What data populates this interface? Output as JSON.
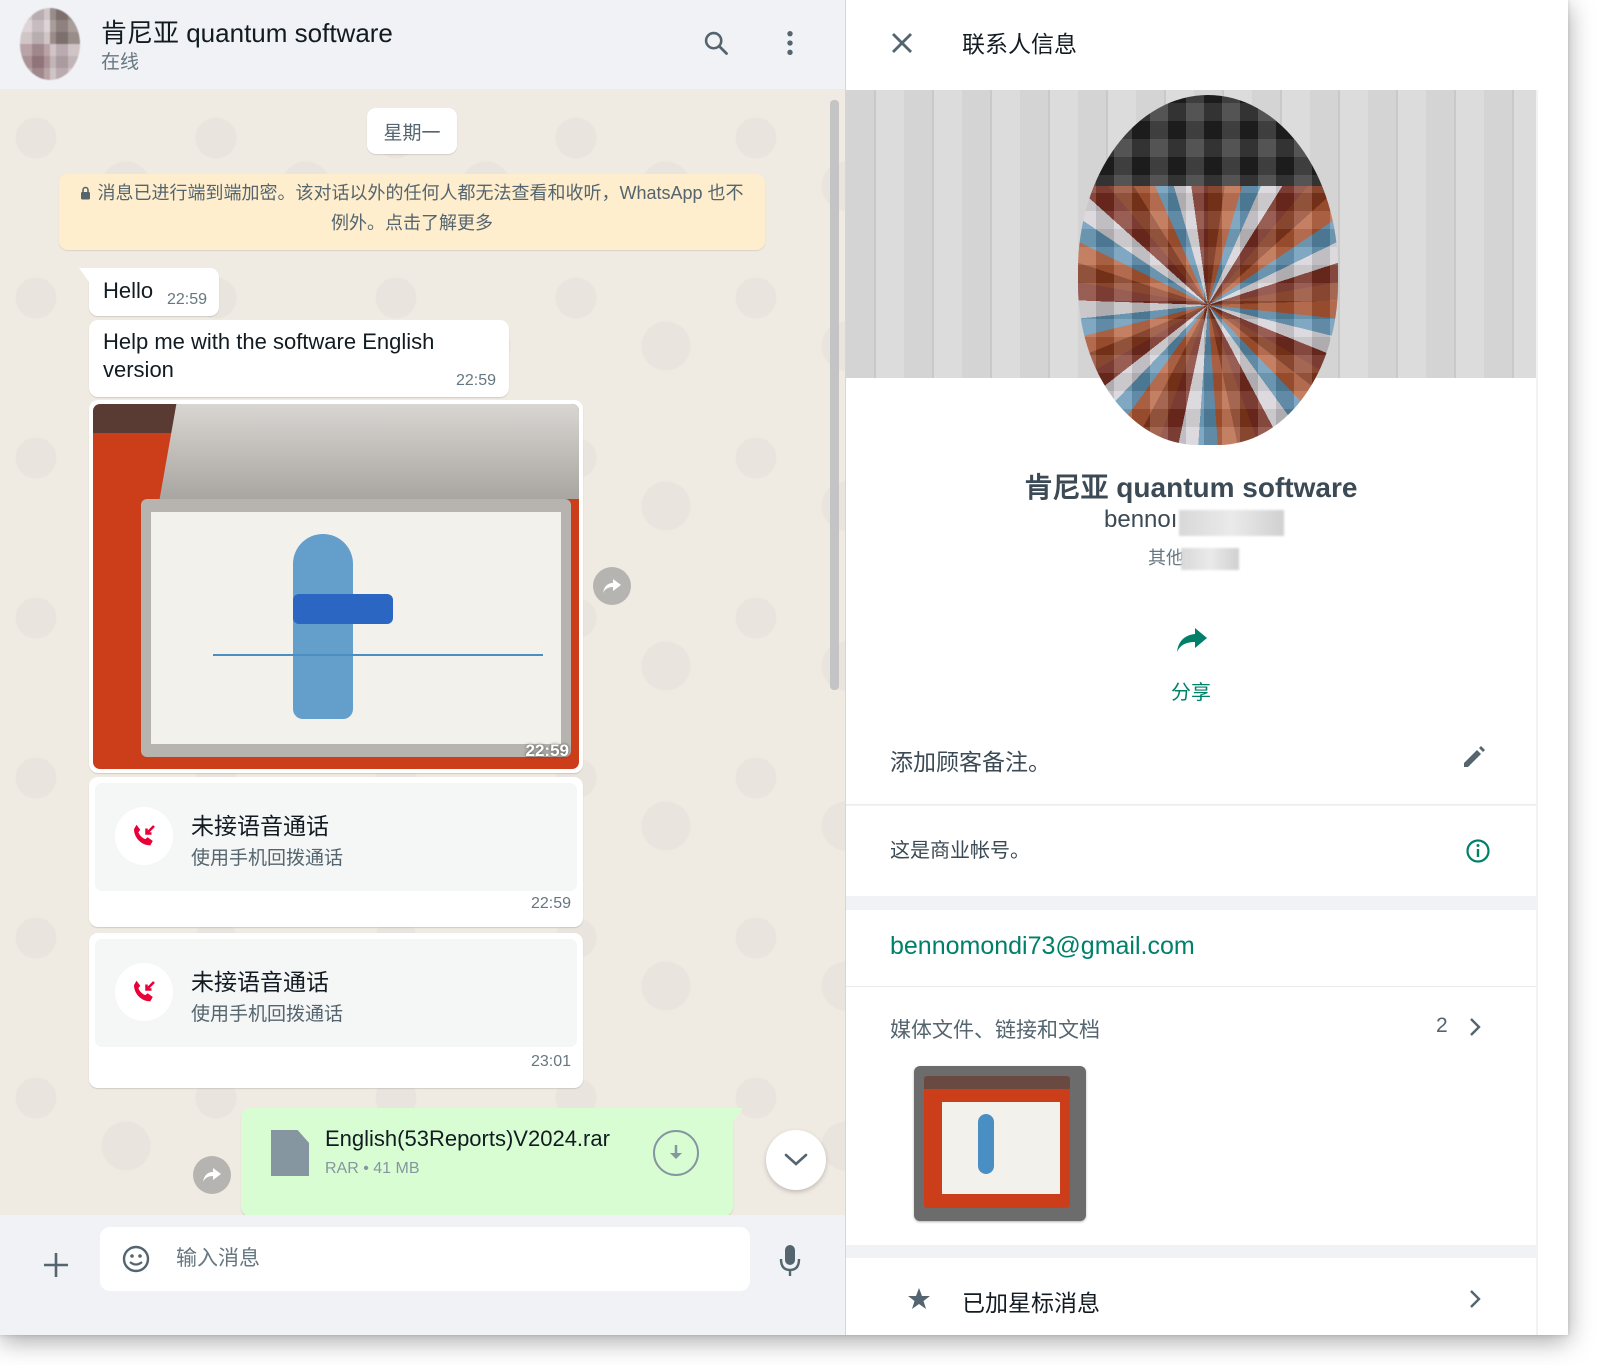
{
  "colors": {
    "accent": "#008069",
    "outgoing_bubble": "#d9fdd3",
    "missed_call": "#ea0038",
    "notice_bg": "#ffeecd"
  },
  "chat": {
    "header": {
      "title": "肯尼亚 quantum software",
      "status": "在线",
      "search_icon": "search-icon",
      "menu_icon": "more-vertical-icon"
    },
    "day_label": "星期一",
    "encryption_notice": "消息已进行端到端加密。该对话以外的任何人都无法查看和收听，WhatsApp 也不例外。点击了解更多",
    "messages": [
      {
        "text": "Hello",
        "time": "22:59"
      },
      {
        "text": "Help me with the software English version",
        "time": "22:59"
      },
      {
        "type": "image",
        "time": "22:59"
      },
      {
        "type": "missed_call",
        "title": "未接语音通话",
        "subtitle": "使用手机回拨通话",
        "time": "22:59"
      },
      {
        "type": "missed_call",
        "title": "未接语音通话",
        "subtitle": "使用手机回拨通话",
        "time": "23:01"
      },
      {
        "type": "file",
        "name": "English(53Reports)V2024.rar",
        "meta": "RAR • 41 MB"
      }
    ],
    "composer": {
      "placeholder": "输入消息"
    }
  },
  "info": {
    "title": "联系人信息",
    "name": "肯尼亚 quantum software",
    "phone_visible": "bennoı",
    "label_visible": "其他",
    "share_label": "分享",
    "note_label": "添加顾客备注。",
    "business_label": "这是商业帐号。",
    "email": "bennomondi73@gmail.com",
    "media_label": "媒体文件、链接和文档",
    "media_count": "2",
    "starred_label": "已加星标消息"
  }
}
